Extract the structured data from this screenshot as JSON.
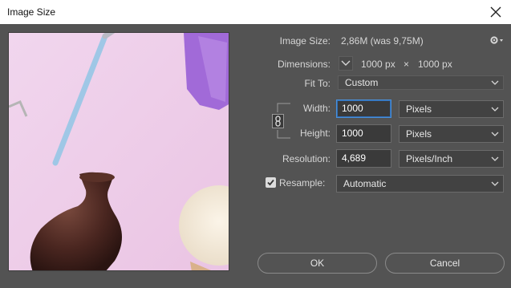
{
  "window": {
    "title": "Image Size"
  },
  "info": {
    "image_size_label": "Image Size:",
    "image_size_value": "2,86M (was 9,75M)",
    "dimensions_label": "Dimensions:",
    "dimensions_width": "1000 px",
    "dimensions_times": "×",
    "dimensions_height": "1000 px"
  },
  "fit_to": {
    "label": "Fit To:",
    "value": "Custom"
  },
  "width": {
    "label": "Width:",
    "value": "1000",
    "unit": "Pixels"
  },
  "height": {
    "label": "Height:",
    "value": "1000",
    "unit": "Pixels"
  },
  "resolution": {
    "label": "Resolution:",
    "value": "4,689",
    "unit": "Pixels/Inch"
  },
  "resample": {
    "label": "Resample:",
    "checked": true,
    "value": "Automatic"
  },
  "buttons": {
    "ok": "OK",
    "cancel": "Cancel"
  },
  "colors": {
    "dialog_bg": "#535353",
    "field_bg": "#3a3a3a",
    "focus_border": "#4a90d9",
    "preview_bg": "#efcde8"
  }
}
